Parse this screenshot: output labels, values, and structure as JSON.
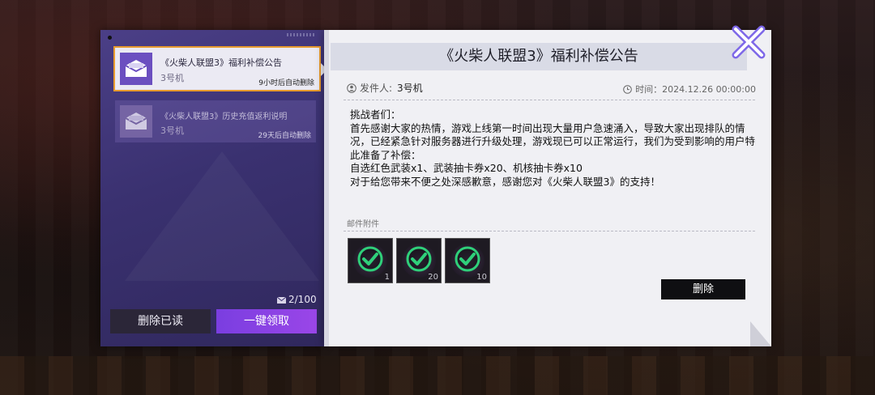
{
  "mail_list": [
    {
      "title": "《火柴人联盟3》福利补偿公告",
      "sender": "3号机",
      "expire": "9小时后自动删除"
    },
    {
      "title": "《火柴人联盟3》历史充值返利说明",
      "sender": "3号机",
      "expire": "29天后自动删除"
    }
  ],
  "mail_count": "2/100",
  "buttons": {
    "delete_read": "删除已读",
    "claim_all": "一键领取",
    "delete": "删除"
  },
  "detail": {
    "title": "《火柴人联盟3》福利补偿公告",
    "sender_label": "发件人:",
    "sender_value": "3号机",
    "time": "时间：2024.12.26 00:00:00",
    "body": [
      "挑战者们：",
      "首先感谢大家的热情，游戏上线第一时间出现大量用户急速涌入，导致大家出现排队的情况，已经紧急针对服务器进行升级处理，游戏现已可以正常运行，我们为受到影响的用户特此准备了补偿：",
      "自选红色武装x1、武装抽卡券x20、机核抽卡券x10",
      "对于给您带来不便之处深感歉意，感谢您对《火柴人联盟3》的支持！"
    ],
    "attachments_label": "邮件附件",
    "attachments": [
      {
        "icon": "red-weapon-icon",
        "qty": "1",
        "claimed": true
      },
      {
        "icon": "weapon-ticket-icon",
        "qty": "20",
        "claimed": true
      },
      {
        "icon": "core-ticket-icon",
        "qty": "10",
        "claimed": true
      }
    ]
  },
  "colors": {
    "accent": "#8a42e6",
    "selected_border": "#e79a2e",
    "check": "#2fd07a"
  }
}
